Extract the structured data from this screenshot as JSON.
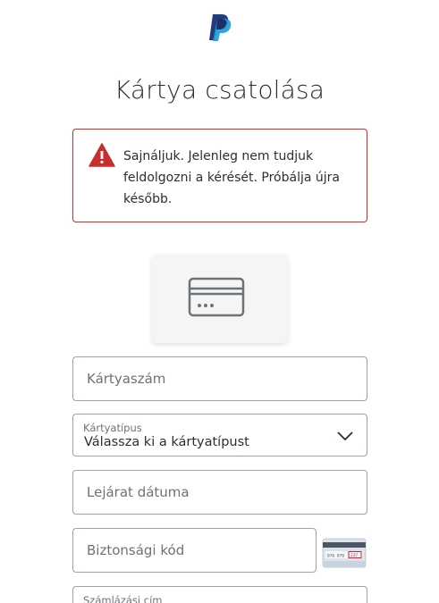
{
  "brand": {
    "logo_icon": "paypal-logo-icon",
    "colors": {
      "dark_blue": "#253b80",
      "light_blue": "#179bd7",
      "error": "#c72e2e"
    }
  },
  "page": {
    "title": "Kártya csatolása"
  },
  "alert": {
    "icon": "warning-triangle-icon",
    "message": "Sajnáljuk. Jelenleg nem tudjuk feldolgozni a kérését. Próbálja újra később."
  },
  "card_preview": {
    "icon": "credit-card-icon"
  },
  "form": {
    "card_number": {
      "placeholder": "Kártyaszám"
    },
    "card_type": {
      "label": "Kártyatípus",
      "value": "Válassza ki a kártyatípust",
      "icon": "chevron-down-icon"
    },
    "expiry": {
      "placeholder": "Lejárat dátuma"
    },
    "security_code": {
      "placeholder": "Biztonsági kód",
      "helper_icon": "cvv-card-icon",
      "helper_digits": "076 870",
      "helper_cvv": "237"
    },
    "billing_address": {
      "label": "Számlázási cím"
    }
  }
}
